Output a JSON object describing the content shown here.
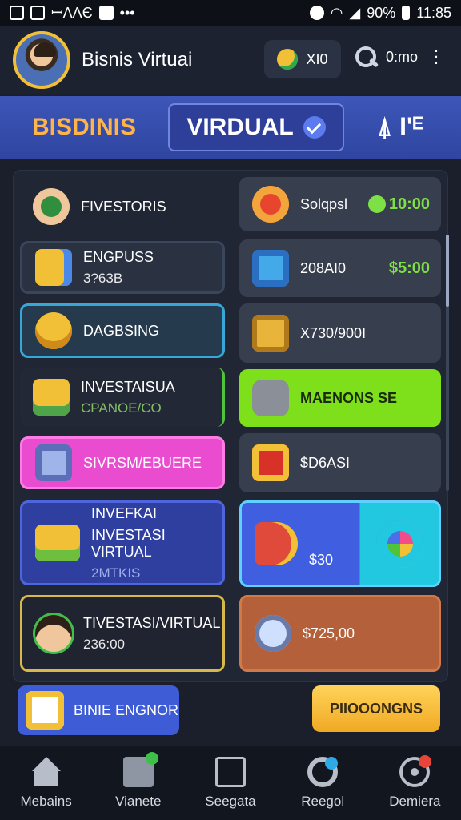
{
  "status_bar": {
    "left_text": "ꟷΛΛЄ",
    "battery": "90%",
    "time": "11:85"
  },
  "header": {
    "title": "Bisnis Virtuai",
    "pill_label": "XI0",
    "search_label": "0:mo",
    "more": "⋮"
  },
  "tabs": [
    {
      "label": "BISDINIS"
    },
    {
      "label": "VIRDUAL"
    },
    {
      "label": "⍋ I'ᴱ"
    }
  ],
  "left_cards": [
    {
      "title": "FIVESTORIS",
      "sub": ""
    },
    {
      "title": "ENGPUSS",
      "sub": "3?63B"
    },
    {
      "title": "DAGBSING",
      "sub": ""
    },
    {
      "title": "INVESTAISUA",
      "sub": "CPANOE/CO"
    },
    {
      "title": "SIVRSM/EBUERE",
      "sub": ""
    },
    {
      "title": "INVEFKAI",
      "sub": "INVESTASI VIRTUAL",
      "sub2": "2MTKIS"
    },
    {
      "title": "TIVESTASI/VIRTUAL",
      "sub": "236:00"
    }
  ],
  "right_cards": [
    {
      "title": "Solqpsl",
      "value": "10:00"
    },
    {
      "title": "208AI0",
      "value": "$5:00"
    },
    {
      "title": "X730/900I",
      "value": ""
    },
    {
      "title": "MAENONS SE",
      "value": ""
    },
    {
      "title": "$D6ASI",
      "value": ""
    },
    {
      "title": "$30",
      "value": ""
    },
    {
      "title": "$725,00",
      "value": ""
    }
  ],
  "actions": {
    "left": "BINIE ENGNOR",
    "right": "PIIOOONGNS"
  },
  "bottom_nav": [
    {
      "label": "Mebains",
      "icon": "home-icon"
    },
    {
      "label": "Vianete",
      "icon": "box-icon"
    },
    {
      "label": "Seegata",
      "icon": "bag-icon"
    },
    {
      "label": "Reegol",
      "icon": "ring-icon"
    },
    {
      "label": "Demiera",
      "icon": "gear-icon"
    }
  ],
  "colors": {
    "accent_blue": "#3d5cd6",
    "accent_green": "#7de045",
    "accent_pink": "#e94ccf",
    "accent_yellow": "#f2c036"
  }
}
